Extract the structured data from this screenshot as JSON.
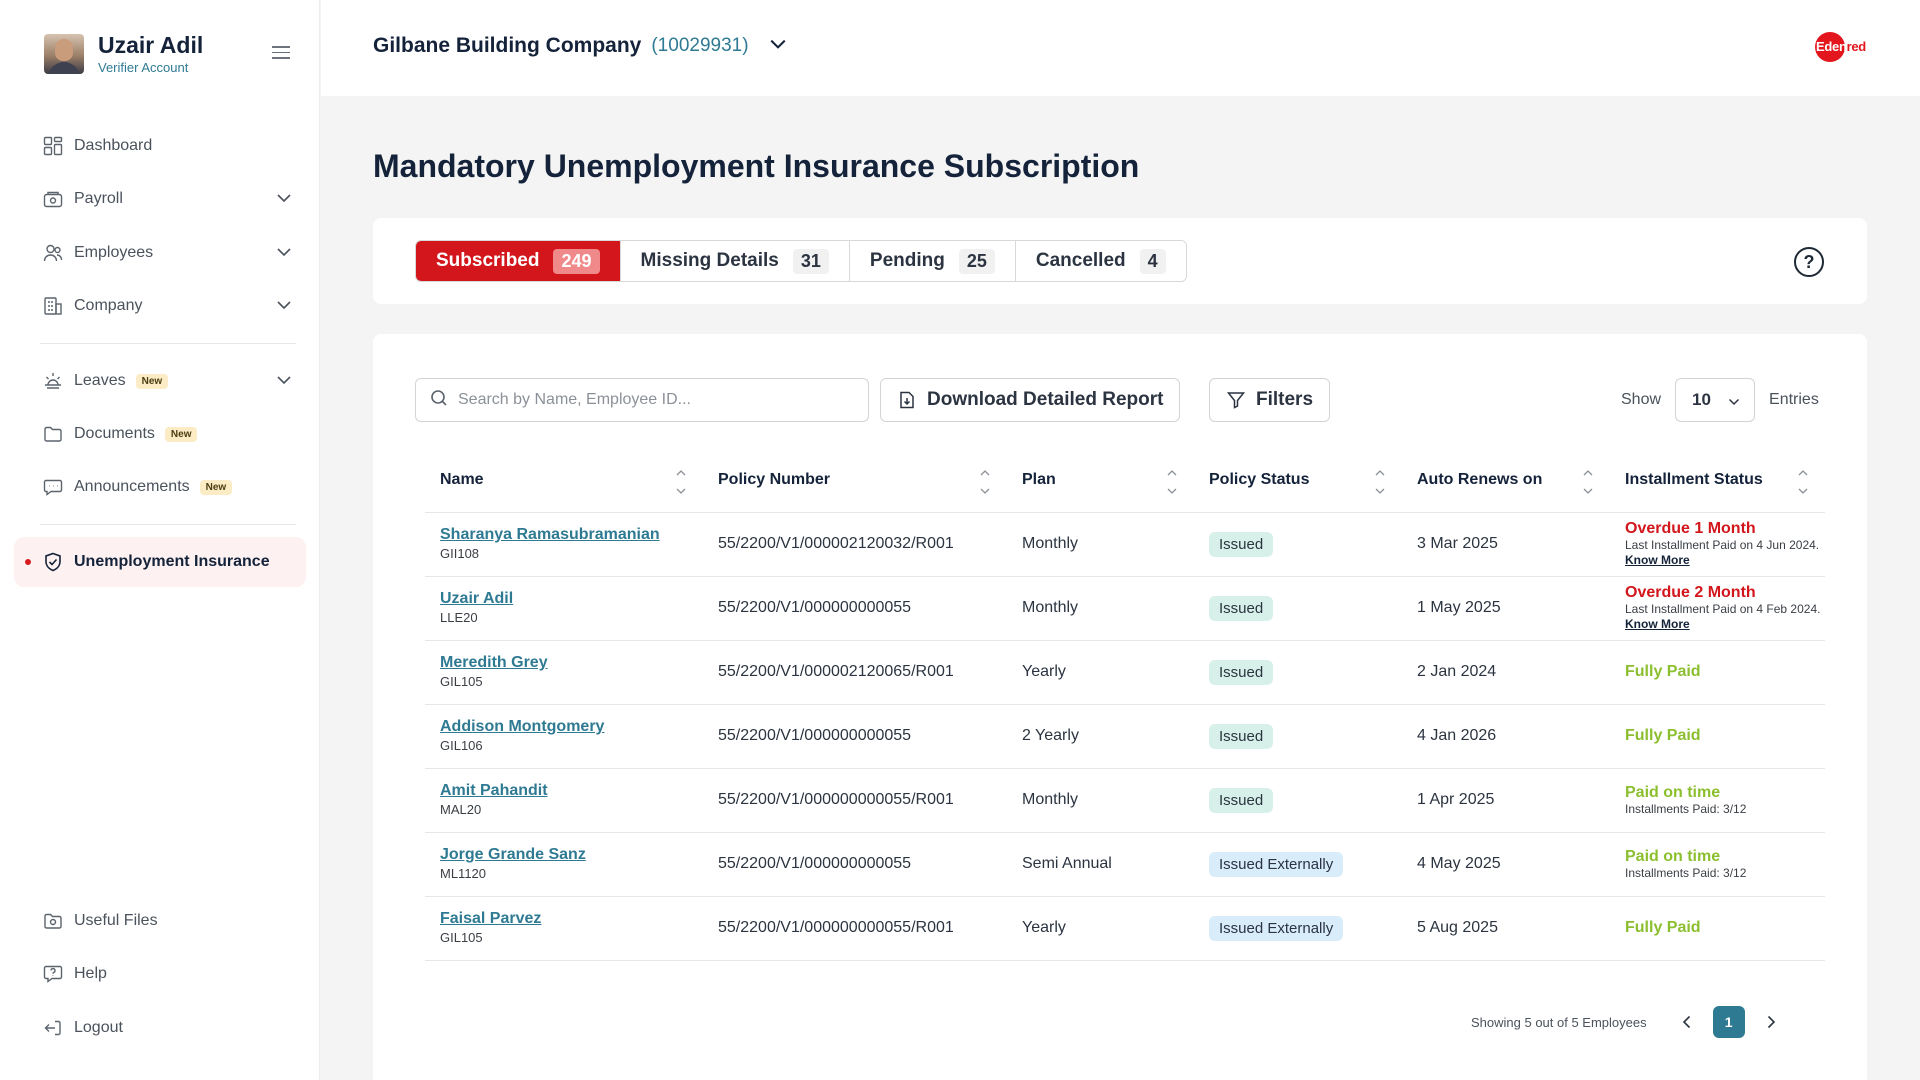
{
  "user": {
    "name": "Uzair Adil",
    "role": "Verifier Account"
  },
  "sidebar": {
    "items": [
      {
        "key": "dashboard",
        "label": "Dashboard"
      },
      {
        "key": "payroll",
        "label": "Payroll"
      },
      {
        "key": "employees",
        "label": "Employees"
      },
      {
        "key": "company",
        "label": "Company"
      },
      {
        "key": "leaves",
        "label": "Leaves",
        "badge": "New"
      },
      {
        "key": "documents",
        "label": "Documents",
        "badge": "New"
      },
      {
        "key": "announcements",
        "label": "Announcements",
        "badge": "New"
      },
      {
        "key": "unemployment",
        "label": "Unemployment Insurance"
      }
    ],
    "bottom": [
      {
        "key": "useful-files",
        "label": "Useful Files"
      },
      {
        "key": "help",
        "label": "Help"
      },
      {
        "key": "logout",
        "label": "Logout"
      }
    ]
  },
  "header": {
    "company_name": "Gilbane Building Company",
    "company_id": "(10029931)",
    "logo_text_a": "Eden",
    "logo_text_b": "red"
  },
  "page": {
    "title": "Mandatory Unemployment Insurance Subscription"
  },
  "tabs": [
    {
      "label": "Subscribed",
      "count": "249"
    },
    {
      "label": "Missing Details",
      "count": "31"
    },
    {
      "label": "Pending",
      "count": "25"
    },
    {
      "label": "Cancelled",
      "count": "4"
    }
  ],
  "help_label": "?",
  "toolbar": {
    "search_placeholder": "Search by Name, Employee ID...",
    "download_label": "Download Detailed Report",
    "filters_label": "Filters",
    "show_label": "Show",
    "entries_value": "10",
    "entries_label": "Entries"
  },
  "table": {
    "columns": [
      "Name",
      "Policy Number",
      "Plan",
      "Policy Status",
      "Auto Renews on",
      "Installment Status"
    ],
    "rows": [
      {
        "name": "Sharanya Ramasubramanian",
        "id": "GII108",
        "policy": "55/2200/V1/000002120032/R001",
        "plan": "Monthly",
        "status": "Issued",
        "renews": "3 Mar 2025",
        "inst_status": "Overdue 1 Month",
        "inst_note": "Last Installment Paid on 4 Jun 2024.",
        "inst_link": "Know More"
      },
      {
        "name": "Uzair Adil",
        "id": "LLE20",
        "policy": "55/2200/V1/000000000055",
        "plan": "Monthly",
        "status": "Issued",
        "renews": "1 May 2025",
        "inst_status": "Overdue 2 Month",
        "inst_note": "Last Installment Paid on 4 Feb 2024.",
        "inst_link": "Know More"
      },
      {
        "name": "Meredith Grey",
        "id": "GIL105",
        "policy": "55/2200/V1/000002120065/R001",
        "plan": "Yearly",
        "status": "Issued",
        "renews": "2 Jan 2024",
        "inst_status": "Fully Paid"
      },
      {
        "name": "Addison Montgomery",
        "id": "GIL106",
        "policy": "55/2200/V1/000000000055",
        "plan": "2 Yearly",
        "status": "Issued",
        "renews": "4 Jan 2026",
        "inst_status": "Fully Paid"
      },
      {
        "name": "Amit Pahandit",
        "id": "MAL20",
        "policy": "55/2200/V1/000000000055/R001",
        "plan": "Monthly",
        "status": "Issued",
        "renews": "1 Apr 2025",
        "inst_status": "Paid on time",
        "inst_note": "Installments Paid: 3/12"
      },
      {
        "name": "Jorge Grande Sanz",
        "id": "ML1120",
        "policy": "55/2200/V1/000000000055",
        "plan": "Semi Annual",
        "status": "Issued Externally",
        "renews": "4 May 2025",
        "inst_status": "Paid on time",
        "inst_note": "Installments Paid: 3/12"
      },
      {
        "name": "Faisal Parvez",
        "id": "GIL105",
        "policy": "55/2200/V1/000000000055/R001",
        "plan": "Yearly",
        "status": "Issued Externally",
        "renews": "5 Aug 2025",
        "inst_status": "Fully Paid"
      }
    ]
  },
  "pagination": {
    "summary": "Showing 5 out of 5 Employees",
    "current_page": "1"
  },
  "colors": {
    "brand_red": "#d2161c",
    "teal": "#2f7a93",
    "green": "#8cbf2f",
    "navy": "#14223a"
  }
}
